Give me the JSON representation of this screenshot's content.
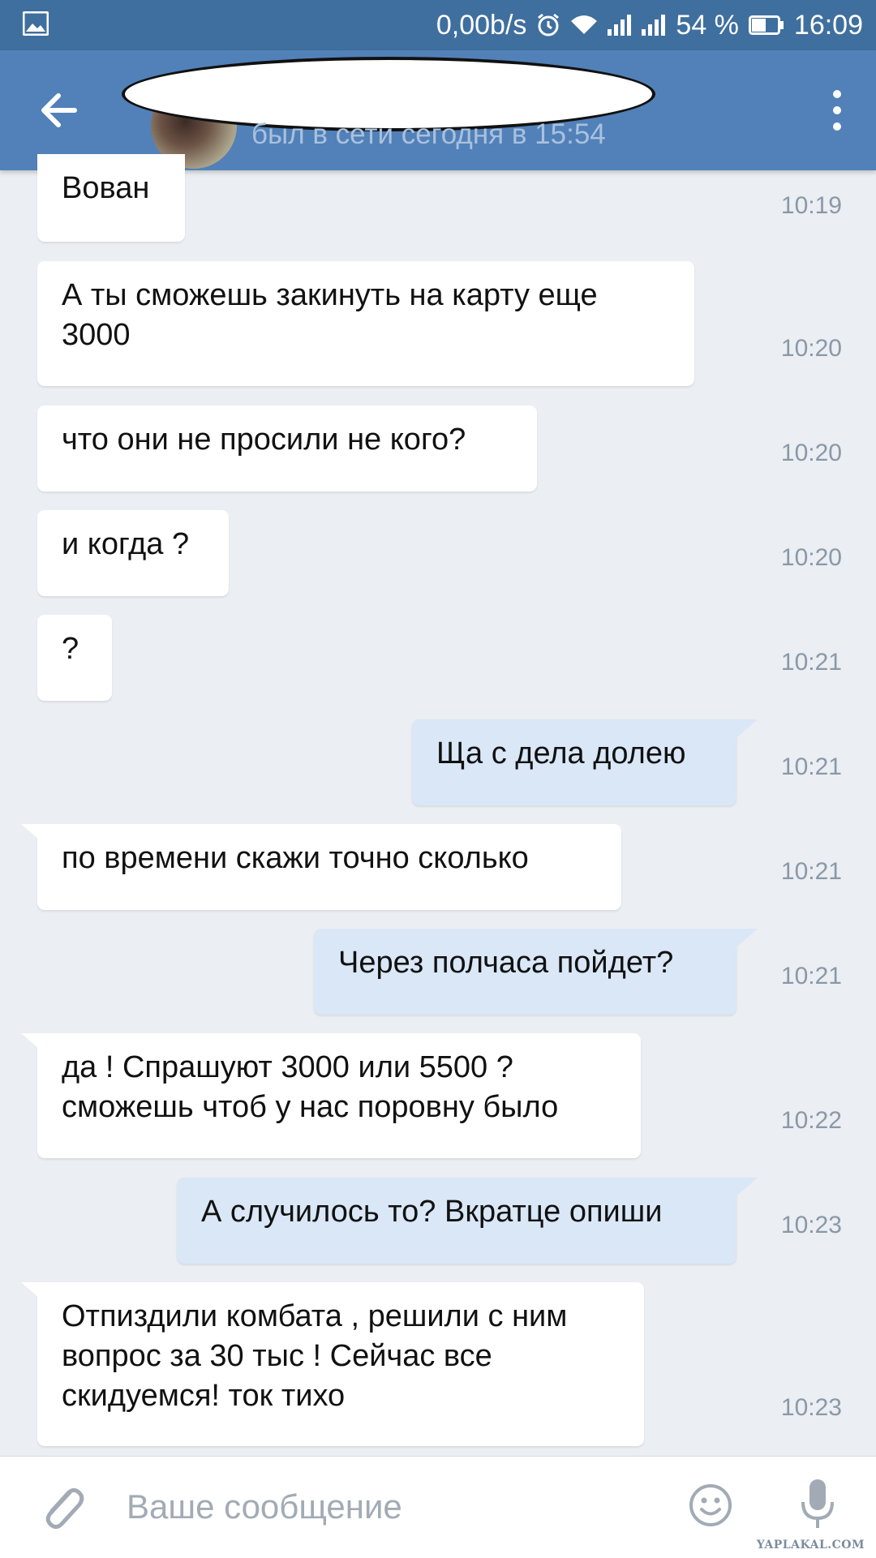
{
  "status_bar": {
    "network_speed": "0,00b/s",
    "battery": "54 %",
    "time": "16:09",
    "icons": [
      "image-icon",
      "alarm-icon",
      "wifi-icon",
      "signal-icon",
      "signal-icon",
      "battery-icon"
    ]
  },
  "header": {
    "status": "был в сети сегодня в 15:54",
    "icons": [
      "back-arrow-icon",
      "more-vert-icon"
    ]
  },
  "messages": [
    {
      "dir": "in",
      "text": "Вован",
      "time": "10:19"
    },
    {
      "dir": "in",
      "text": "А ты сможешь закинуть на карту еще 3000",
      "time": "10:20"
    },
    {
      "dir": "in",
      "text": "что они не просили не кого?",
      "time": "10:20"
    },
    {
      "dir": "in",
      "text": "и когда ?",
      "time": "10:20"
    },
    {
      "dir": "in",
      "text": "?",
      "time": "10:21"
    },
    {
      "dir": "out",
      "text": "Ща с дела долею",
      "time": "10:21"
    },
    {
      "dir": "in",
      "text": "по времени скажи точно сколько",
      "time": "10:21"
    },
    {
      "dir": "out",
      "text": "Через полчаса пойдет?",
      "time": "10:21"
    },
    {
      "dir": "in",
      "text": "да ! Спрашуют 3000 или 5500 ? сможешь чтоб у нас поровну было",
      "time": "10:22"
    },
    {
      "dir": "out",
      "text": "А случилось то? Вкратце опиши",
      "time": "10:23"
    },
    {
      "dir": "in",
      "text": "Отпиздили комбата , решили с ним вопрос за 30 тыс ! Сейчас все скидуемся! ток тихо",
      "time": "10:23"
    }
  ],
  "input": {
    "placeholder": "Ваше сообщение",
    "value": "",
    "icons": [
      "attach-icon",
      "emoji-icon",
      "mic-icon"
    ]
  },
  "watermark": "YAPLAKAL.COM",
  "colors": {
    "header": "#5181b8",
    "status_bar": "#3f6f9e",
    "background": "#ebeef2",
    "incoming_bubble": "#ffffff",
    "outgoing_bubble": "#d9e7f7",
    "time_text": "#8a98a8"
  }
}
